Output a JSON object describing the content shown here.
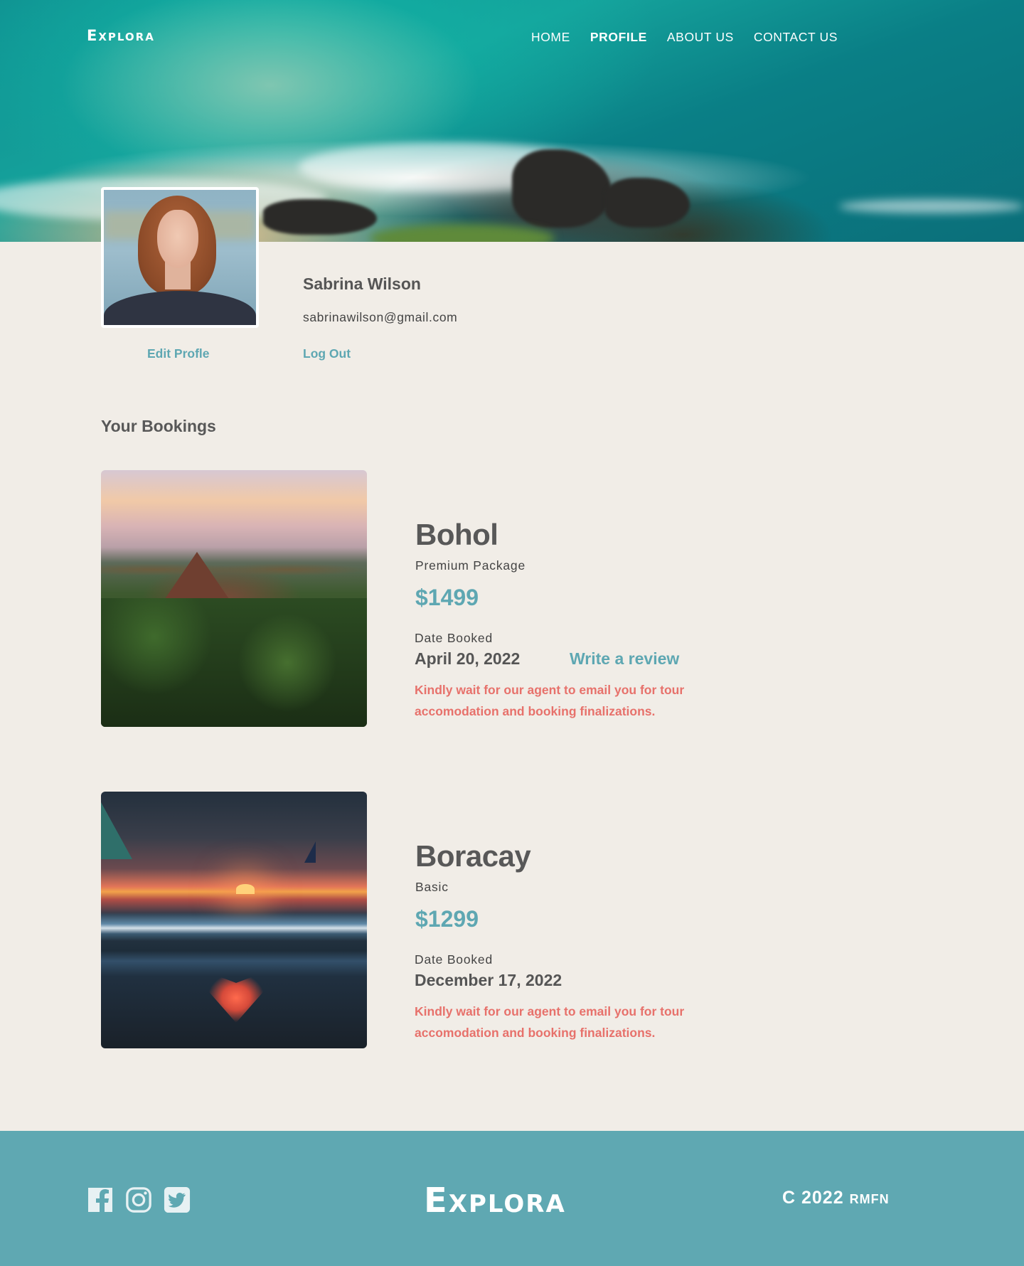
{
  "nav": {
    "logo": "Explora",
    "links": [
      {
        "label": "HOME",
        "active": false
      },
      {
        "label": "PROFILE",
        "active": true
      },
      {
        "label": "ABOUT US",
        "active": false
      },
      {
        "label": "CONTACT US",
        "active": false
      }
    ]
  },
  "profile": {
    "name": "Sabrina Wilson",
    "email": "sabrinawilson@gmail.com",
    "edit_label": "Edit Profle",
    "logout_label": "Log Out"
  },
  "bookings": {
    "title": "Your Bookings",
    "items": [
      {
        "destination": "Bohol",
        "package": "Premium Package",
        "price": "$1499",
        "date_label": "Date Booked",
        "date": "April 20, 2022",
        "review_label": "Write a review",
        "note": "Kindly wait for our agent to email you for tour accomodation and booking finalizations."
      },
      {
        "destination": "Boracay",
        "package": "Basic",
        "price": "$1299",
        "date_label": "Date Booked",
        "date": "December 17, 2022",
        "note": "Kindly wait for our agent to email you for tour accomodation and booking finalizations."
      }
    ]
  },
  "footer": {
    "logo": "Explora",
    "copyright_main": "C 2022",
    "copyright_small": "RMFN",
    "social_icons": [
      "facebook-icon",
      "instagram-icon",
      "twitter-icon"
    ]
  },
  "colors": {
    "accent": "#5ea7b2",
    "note": "#e7716b",
    "background": "#f1ede7",
    "footer": "#5fa8b2"
  }
}
